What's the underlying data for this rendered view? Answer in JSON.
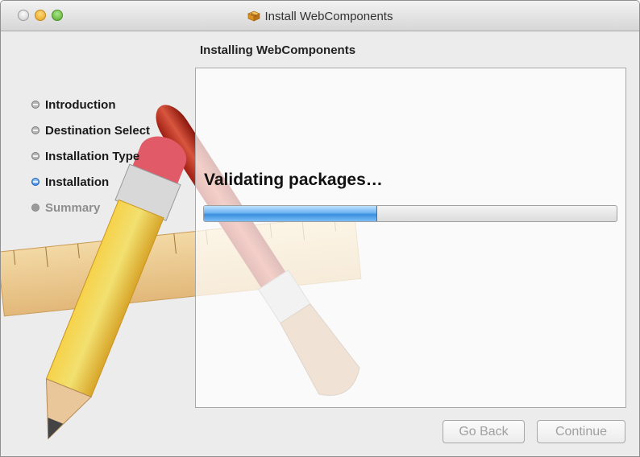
{
  "window": {
    "title": "Install WebComponents",
    "icon": "package-icon"
  },
  "header": {
    "heading": "Installing WebComponents"
  },
  "sidebar": {
    "steps": [
      {
        "label": "Introduction",
        "state": "done"
      },
      {
        "label": "Destination Select",
        "state": "done"
      },
      {
        "label": "Installation Type",
        "state": "done"
      },
      {
        "label": "Installation",
        "state": "current"
      },
      {
        "label": "Summary",
        "state": "pending"
      }
    ]
  },
  "main": {
    "status": "Validating packages…",
    "progress": 0.42
  },
  "footer": {
    "back_label": "Go Back",
    "continue_label": "Continue"
  },
  "colors": {
    "progress_fill": "#3a8fe0",
    "current_step": "#2d7be0"
  }
}
